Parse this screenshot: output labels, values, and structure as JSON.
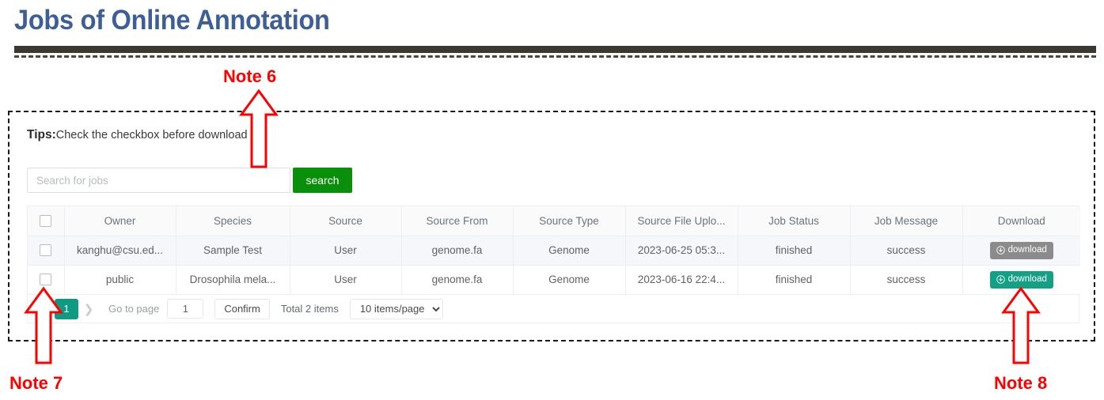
{
  "page": {
    "title": "Jobs of Online Annotation"
  },
  "panel": {
    "tips_label": "Tips:",
    "tips_text": "Check the checkbox before download"
  },
  "search": {
    "placeholder": "Search for jobs",
    "value": "",
    "button_label": "search",
    "button_color": "#0a8f0a"
  },
  "table": {
    "columns": [
      "",
      "Owner",
      "Species",
      "Source",
      "Source From",
      "Source Type",
      "Source File Uplo...",
      "Job Status",
      "Job Message",
      "Download"
    ],
    "rows": [
      {
        "checked": false,
        "owner": "kanghu@csu.ed...",
        "species": "Sample Test",
        "source": "User",
        "source_from": "genome.fa",
        "source_type": "Genome",
        "upload_time": "2023-06-25 05:3...",
        "job_status": "finished",
        "job_message": "success",
        "download_label": "download",
        "download_state": "gray",
        "download_color": "#8b8b8b"
      },
      {
        "checked": false,
        "owner": "public",
        "species": "Drosophila mela...",
        "source": "User",
        "source_from": "genome.fa",
        "source_type": "Genome",
        "upload_time": "2023-06-16 22:4...",
        "job_status": "finished",
        "job_message": "success",
        "download_label": "download",
        "download_state": "teal",
        "download_color": "#13a085"
      }
    ]
  },
  "pagination": {
    "prev_icon": "chevron-left",
    "next_icon": "chevron-right",
    "current_page": "1",
    "goto_label": "Go to page",
    "goto_value": "1",
    "confirm_label": "Confirm",
    "total_label": "Total 2 items",
    "page_size_label": "10 items/page",
    "active_color": "#0f9a84"
  },
  "annotations": {
    "color": "#ff0000",
    "notes": [
      {
        "label": "Note 6"
      },
      {
        "label": "Note 7"
      },
      {
        "label": "Note 8"
      }
    ]
  }
}
